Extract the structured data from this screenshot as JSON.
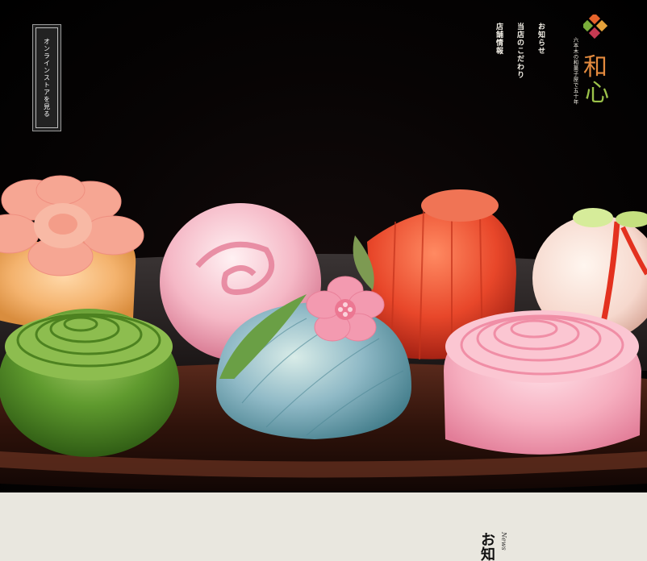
{
  "header": {
    "online_store_label": "オンラインストアを見る",
    "nav": [
      "お知らせ",
      "当店のこだわり",
      "店舗情報"
    ]
  },
  "logo": {
    "tagline": "六本木の和菓子屋で五十年",
    "name_1": "和",
    "name_2": "心",
    "colors": [
      "#e7642b",
      "#7aae3a",
      "#e6a23a",
      "#c63a52"
    ]
  },
  "news": {
    "title_jp": "お知",
    "title_en": "News"
  }
}
